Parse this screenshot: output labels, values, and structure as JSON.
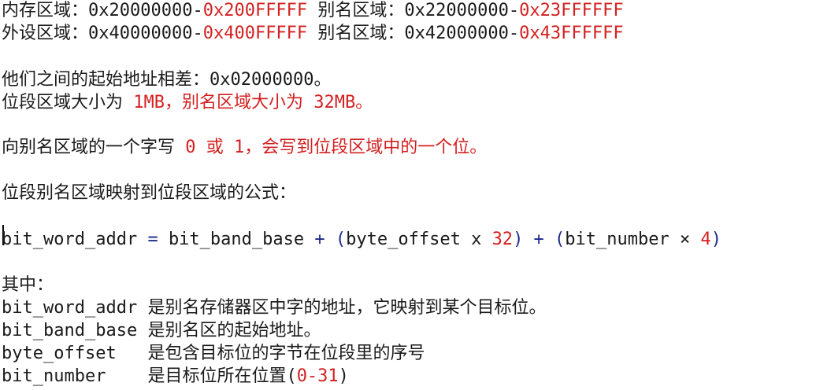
{
  "memory": {
    "label_mem": "内存区域：",
    "mem_start": "0x20000000-",
    "mem_end": "0x200FFFFF",
    "alias_label_1": " 别名区域：",
    "alias_start_1": "0x22000000-",
    "alias_end_1": "0x23FFFFFF",
    "label_periph": "外设区域：",
    "periph_start": "0x40000000-",
    "periph_end": "0x400FFFFF",
    "alias_label_2": " 别名区域：",
    "alias_start_2": "0x42000000-",
    "alias_end_2": "0x43FFFFFF"
  },
  "offset": {
    "text": "他们之间的起始地址相差：0x02000000。"
  },
  "sizes": {
    "prefix": "位段区域大小为 ",
    "bitband_size": "1MB，别名区域大小为 32MB。"
  },
  "write": {
    "prefix": "向别名区域的一个字写 ",
    "rest": "0 或 1，会写到位段区域中的一个位。"
  },
  "formula_heading": {
    "text": "位段别名区域映射到位段区域的公式："
  },
  "formula": {
    "p1": "bit_word_addr ",
    "p2": "= ",
    "p3": "bit_band_base ",
    "p4": "+ (",
    "p5": "byte_offset x ",
    "p6": "32",
    "p7": ") + (",
    "p8": "bit_number × ",
    "p9": "4",
    "p10": ")"
  },
  "where": {
    "heading": "其中：",
    "defs": [
      {
        "term": "bit_word_addr ",
        "desc": "是别名存储器区中字的地址，它映射到某个目标位。"
      },
      {
        "term": "bit_band_base ",
        "desc": "是别名区的起始地址。"
      },
      {
        "term": "byte_offset   ",
        "desc": "是包含目标位的字节在位段里的序号"
      },
      {
        "term": "bit_number    ",
        "desc": "是目标位所在位置(",
        "range": "0-31",
        "close": ")"
      }
    ]
  }
}
